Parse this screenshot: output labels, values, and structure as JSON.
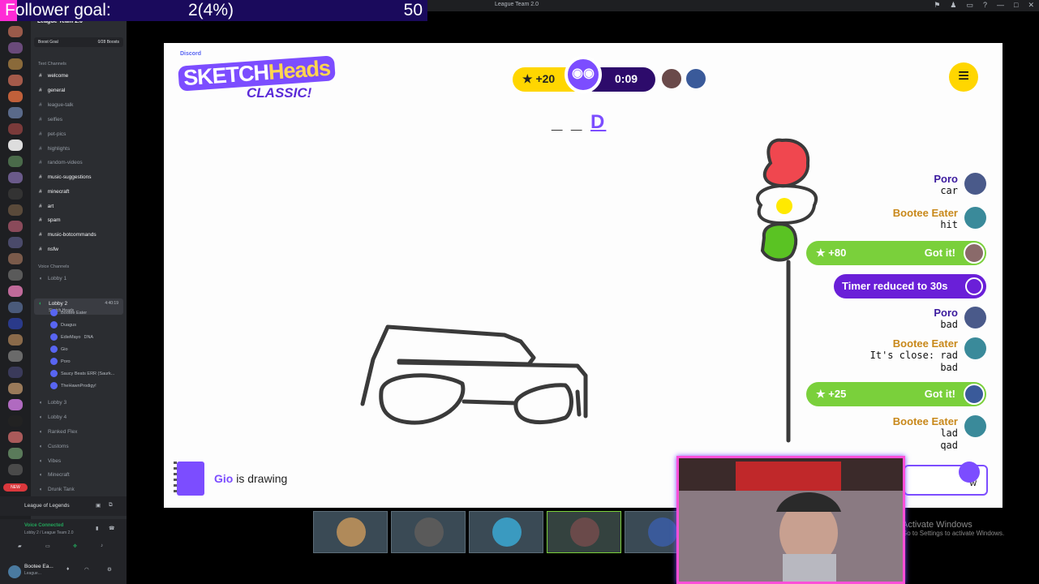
{
  "goal": {
    "label": "Follower goal:",
    "value": "2(4%)",
    "max": "50",
    "progress": 0.04,
    "colors": {
      "bar": "#1a0a5c",
      "fill": "#ff2bd6"
    }
  },
  "window": {
    "title": "League Team 2.0",
    "icons": [
      "pin-icon",
      "people-icon",
      "inbox-icon",
      "help-icon",
      "minimize-icon",
      "maximize-icon",
      "close-icon"
    ]
  },
  "sidebar": {
    "server_name": "League Team 2.0",
    "boost": {
      "label": "Boost Goal",
      "count": "0/28 Boosts"
    },
    "text_category": "Text Channels",
    "channels": [
      {
        "name": "welcome",
        "bold": true
      },
      {
        "name": "general",
        "bold": true
      },
      {
        "name": "league-talk",
        "bold": false
      },
      {
        "name": "selfies",
        "bold": false
      },
      {
        "name": "pet-pics",
        "bold": false
      },
      {
        "name": "highlights",
        "bold": false
      },
      {
        "name": "random-videos",
        "bold": false
      },
      {
        "name": "music-suggestions",
        "bold": true
      },
      {
        "name": "minecraft",
        "bold": true
      },
      {
        "name": "art",
        "bold": true
      },
      {
        "name": "spam",
        "bold": true
      },
      {
        "name": "music-botcommands",
        "bold": true
      },
      {
        "name": "nsfw",
        "bold": true
      }
    ],
    "voice_category": "Voice Channels",
    "lobby1": "Lobby 1",
    "lobby2": {
      "name": "Lobby 2",
      "sub": "Sketch Heads",
      "time": "4:40:19"
    },
    "voice_users": [
      "Bootee Eater",
      "Duagus",
      "EdieMayo",
      "Gio",
      "Poro",
      "Saucy Beats ERR (Saurk...",
      "TheHawnProdigy!"
    ],
    "voice_user_badge": "DNA",
    "other_voice": [
      "Lobby 3",
      "Lobby 4",
      "Ranked Flex",
      "Customs",
      "Vibes",
      "Minecraft",
      "Drunk Tank"
    ],
    "new_badge": "NEW",
    "activity": "League of Legends",
    "voice_connected": {
      "title": "Voice Connected",
      "sub": "Lobby 2 / League Team 2.0"
    },
    "user": {
      "name": "Bootee Ea...",
      "status": "League..."
    }
  },
  "game": {
    "logo": {
      "discord": "Discord",
      "sketch": "SKETCH",
      "heads": "Heads",
      "classic": "CLASSIC!"
    },
    "points": "+20",
    "time": "0:09",
    "word_blanks": "_ _",
    "word_revealed": "D",
    "drawer": "Gio",
    "drawing_text": "is drawing",
    "input_value": "w",
    "chat": [
      {
        "type": "msg",
        "name": "Poro",
        "color": "purple",
        "lines": [
          "car"
        ]
      },
      {
        "type": "msg",
        "name": "Bootee Eater",
        "color": "gold",
        "lines": [
          "hit"
        ]
      },
      {
        "type": "got",
        "points": "+80",
        "label": "Got it!"
      },
      {
        "type": "timer",
        "label": "Timer reduced to 30s"
      },
      {
        "type": "msg",
        "name": "Poro",
        "color": "purple",
        "lines": [
          "bad"
        ]
      },
      {
        "type": "msg",
        "name": "Bootee Eater",
        "color": "gold",
        "lines": [
          "It's close: rad",
          "bad"
        ]
      },
      {
        "type": "got",
        "points": "+25",
        "label": "Got it!"
      },
      {
        "type": "msg",
        "name": "Bootee Eater",
        "color": "gold",
        "lines": [
          "lad",
          "qad"
        ]
      }
    ],
    "colors": {
      "purple": "#7c4dff",
      "yellow": "#ffd600",
      "green": "#7ad03b"
    }
  },
  "watermark": {
    "title": "Activate Windows",
    "sub": "Go to Settings to activate Windows."
  }
}
